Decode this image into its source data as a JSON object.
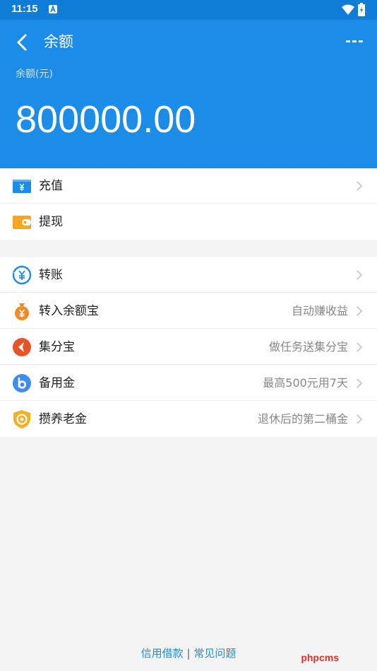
{
  "status_bar": {
    "time": "11:15",
    "notification_icon": "a-icon",
    "wifi_icon": "wifi-icon",
    "battery_icon": "battery-charging-icon"
  },
  "header": {
    "back_icon": "back-arrow-icon",
    "title": "余额",
    "more_icon": "more-dots-icon",
    "balance_label": "余额(元)",
    "balance_value": "800000.00",
    "accent": "#1b8ce8"
  },
  "top_actions": [
    {
      "label": "充值",
      "icon": "recharge-card-icon",
      "color": "#1b8ce8",
      "hint": "",
      "chevron": true
    },
    {
      "label": "提现",
      "icon": "wallet-icon",
      "color": "#f5a623",
      "hint": "",
      "chevron": false
    }
  ],
  "services": [
    {
      "label": "转账",
      "icon": "transfer-icon",
      "color": "#1b8ce8",
      "hint": ""
    },
    {
      "label": "转入余额宝",
      "icon": "money-bag-icon",
      "color": "#f08a24",
      "hint": "自动赚收益"
    },
    {
      "label": "集分宝",
      "icon": "jifenbao-icon",
      "color": "#e8532a",
      "hint": "做任务送集分宝"
    },
    {
      "label": "备用金",
      "icon": "reserve-fund-icon",
      "color": "#3d8ef0",
      "hint": "最高500元用7天"
    },
    {
      "label": "攒养老金",
      "icon": "pension-shield-icon",
      "color": "#f5b021",
      "hint": "退休后的第二桶金"
    }
  ],
  "footer": {
    "link_credit": "信用借款",
    "separator": "|",
    "link_faq": "常见问题"
  },
  "watermark": "phpcms"
}
